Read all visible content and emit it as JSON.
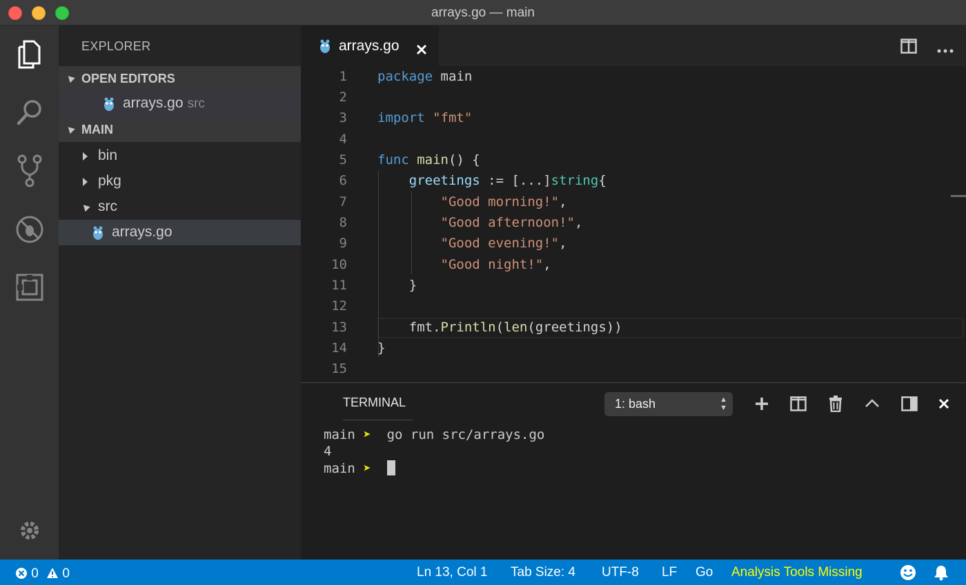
{
  "window": {
    "title": "arrays.go — main"
  },
  "sidebar": {
    "title": "EXPLORER",
    "open_editors_label": "OPEN EDITORS",
    "open_editors": [
      {
        "name": "arrays.go",
        "folder": "src"
      }
    ],
    "root_label": "MAIN",
    "tree": [
      {
        "name": "bin"
      },
      {
        "name": "pkg"
      },
      {
        "name": "src"
      },
      {
        "name": "arrays.go"
      }
    ]
  },
  "tab": {
    "label": "arrays.go"
  },
  "editor": {
    "line_numbers": [
      "1",
      "2",
      "3",
      "4",
      "5",
      "6",
      "7",
      "8",
      "9",
      "10",
      "11",
      "12",
      "13",
      "14",
      "15"
    ],
    "tokens": {
      "package": "package",
      "main": "main",
      "import": "import",
      "fmt_str": "\"fmt\"",
      "func": "func",
      "main_fn": "main",
      "parens": "() {",
      "greetings": "greetings",
      "assign": " := [...]",
      "string": "string",
      "brace": "{",
      "s1": "\"Good morning!\"",
      "s2": "\"Good afternoon!\"",
      "s3": "\"Good evening!\"",
      "s4": "\"Good night!\"",
      "comma": ",",
      "close_brace": "}",
      "fmt": "fmt",
      "dot": ".",
      "println": "Println",
      "open": "(",
      "len": "len",
      "arg": "(greetings))"
    }
  },
  "panel": {
    "tab_label": "TERMINAL",
    "terminal_select": "1: bash",
    "lines": [
      {
        "prompt": "main",
        "arrow": "➤",
        "command": "go run src/arrays.go"
      },
      {
        "output": "4"
      },
      {
        "prompt": "main",
        "arrow": "➤"
      }
    ]
  },
  "statusbar": {
    "errors": "0",
    "warnings": "0",
    "position": "Ln 13, Col 1",
    "tab_size": "Tab Size: 4",
    "encoding": "UTF-8",
    "eol": "LF",
    "language": "Go",
    "analysis": "Analysis Tools Missing"
  },
  "colors": {
    "accent": "#007acc",
    "keyword": "#569cd6",
    "string": "#ce9178",
    "function": "#dcdcaa",
    "variable": "#9cdcfe",
    "type": "#4ec9b0",
    "warning": "#ffff00"
  },
  "icons": [
    "files-icon",
    "search-icon",
    "source-control-icon",
    "debug-icon",
    "extensions-icon",
    "gear-icon",
    "gopher-file-icon",
    "split-editor-icon",
    "more-icon",
    "plus-icon",
    "split-terminal-icon",
    "trash-icon",
    "chevron-up-icon",
    "maximize-panel-icon",
    "close-icon",
    "error-icon",
    "warning-icon",
    "smiley-icon",
    "bell-icon"
  ]
}
